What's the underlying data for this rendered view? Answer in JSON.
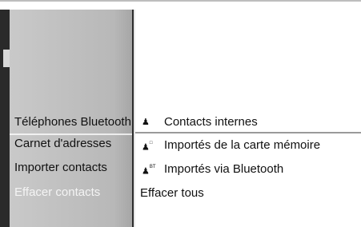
{
  "left_menu": {
    "items": [
      {
        "label": "Téléphones Bluetooth",
        "selected": false
      },
      {
        "label": "Carnet d'adresses",
        "selected": false
      },
      {
        "label": "Importer contacts",
        "selected": false
      },
      {
        "label": "Effacer contacts",
        "selected": true
      }
    ]
  },
  "submenu": {
    "items": [
      {
        "label": "Contacts internes",
        "icon": "person-icon"
      },
      {
        "label": "Importés de la carte mémoire",
        "icon": "person-memory-card-icon"
      },
      {
        "label": "Importés via Bluetooth",
        "icon": "person-bluetooth-icon",
        "icon_text": "BT"
      },
      {
        "label": "Effacer tous",
        "icon": ""
      }
    ]
  },
  "colors": {
    "panel": "#b8b8b8",
    "selected_text": "#f4f4f4",
    "text": "#111111"
  }
}
